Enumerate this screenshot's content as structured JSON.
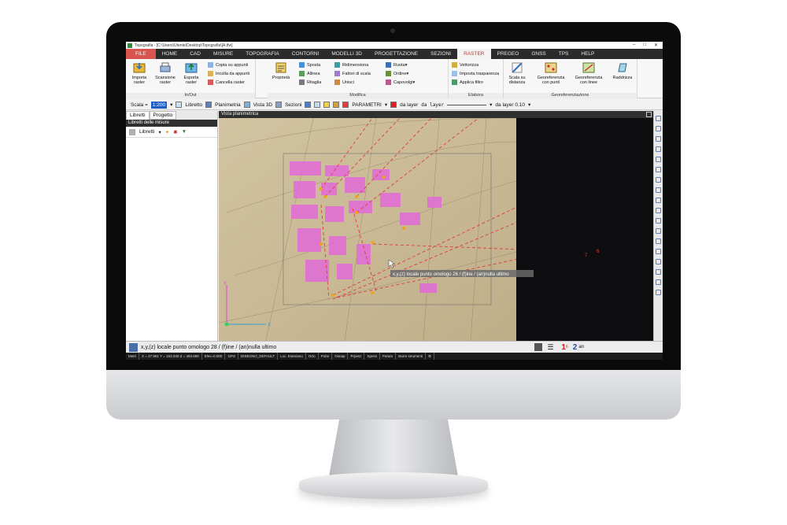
{
  "window": {
    "title": "Topografia - [C:\\Users\\Utente\\Desktop\\Topografia\\[A.tfw]"
  },
  "menu": {
    "tabs": [
      "FILE",
      "HOME",
      "CAD",
      "MISURE",
      "TOPOGRAFIA",
      "CONTORNI",
      "MODELLI 3D",
      "PROGETTAZIONE",
      "SEZIONI",
      "RASTER",
      "PREGEO",
      "GNSS",
      "TPS",
      "HELP"
    ]
  },
  "ribbon": {
    "inout": {
      "label": "In/Out",
      "importa": "Importa raster",
      "scansione": "Scansione raster",
      "esporta": "Esporta raster",
      "copia": "Copia su appunti",
      "incolla": "Incolla da appunti",
      "cancella": "Cancella raster"
    },
    "modifica": {
      "label": "Modifica",
      "proprieta": "Proprietà",
      "sposta": "Sposta",
      "allinea": "Allinea",
      "ritaglia": "Ritaglia",
      "ridimensiona": "Ridimensiona",
      "fattori": "Fattori di scala",
      "unisci": "Unisci",
      "ruota": "Ruota",
      "ordine": "Ordine",
      "capovolgi": "Capovolgi"
    },
    "elabora": {
      "label": "Elabora",
      "vettorizza": "Vettorizza",
      "trasparenza": "Imposta trasparenza",
      "filtro": "Applica filtro"
    },
    "georef": {
      "label": "Georeferenziazione",
      "scala": "Scala su distanza",
      "punti": "Georeferenzia con punti",
      "linee": "Georeferenzia con linee",
      "raddrizza": "Raddrizza"
    }
  },
  "toolbar": {
    "scala_label": "Scala =",
    "scala_value": "1:200",
    "libretto": "Libretto",
    "planimetria": "Planimetria",
    "vista3d": "Vista 3D",
    "sezioni": "Sezioni",
    "parametri": "PARAMETRI",
    "layer_color": "da layer",
    "layer_line": "da layer",
    "layer_width": "da layer 0.10"
  },
  "leftpanel": {
    "tab_libretti": "Libretti",
    "tab_progetto": "Progetto",
    "header": "Libretti delle misure",
    "tool_libretti": "Libretti"
  },
  "view": {
    "title": "Vista planimetrica",
    "tooltip": "x,y,(z) locale punto omologo 26 / (f)ine / (an)nulla ultimo",
    "axis_y": "Y",
    "axis_x": "X",
    "marker_7": "7",
    "marker_6": "6"
  },
  "cmdbar": {
    "prompt": "x,y,(z) locale punto omologo 28 / (f)ine / (an)nulla ultimo",
    "n1": "1",
    "n1sub": "6",
    "n2": "2",
    "n2sub": "an"
  },
  "statusbar": {
    "items": [
      "Metri",
      "X = 27.961  Y = 153.340  Z = 493.696",
      "Elev=0.000",
      "GPS",
      "DISEGNO_DEFAULT",
      "Loc. Esteriano",
      "Orto",
      "Polar",
      "Osnap",
      "Prpesz",
      "Spess",
      "Param",
      "Barre strumenti"
    ]
  },
  "colors": {
    "accent": "#d9534f",
    "raster_tab": "#c0392b",
    "dashed_lines": "#e23b3b",
    "pink_marks": "#e36bd8",
    "points": "#f0a21a"
  }
}
